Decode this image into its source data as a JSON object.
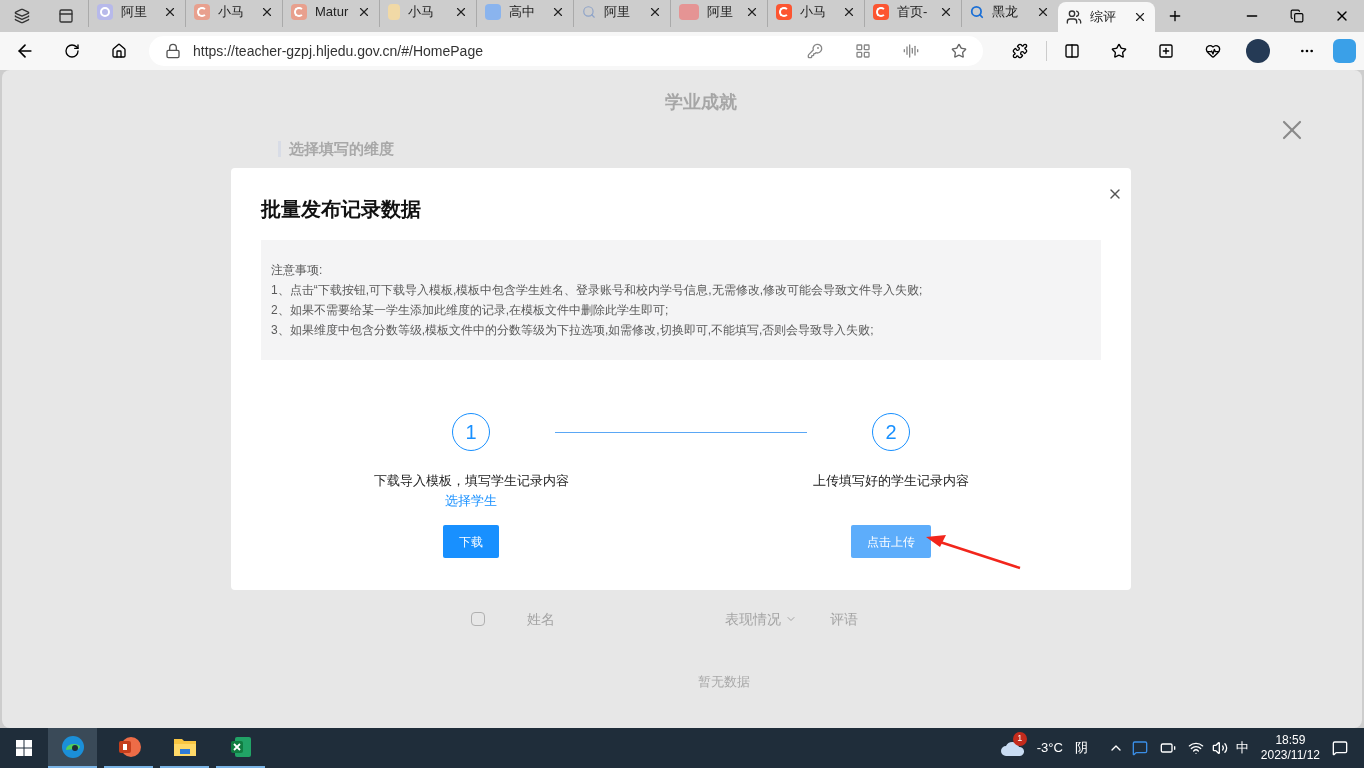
{
  "browser": {
    "tabs": [
      {
        "kind": "ring",
        "title": "阿里",
        "selected": false
      },
      {
        "kind": "c-logo",
        "title": "小马",
        "selected": false
      },
      {
        "kind": "c-logo",
        "title": "Matur",
        "selected": false
      },
      {
        "kind": "bookmark",
        "title": "小马",
        "selected": false
      },
      {
        "kind": "zhi",
        "title": "高中",
        "selected": false
      },
      {
        "kind": "search",
        "title": "阿里",
        "selected": false
      },
      {
        "kind": "it",
        "title": "阿里",
        "selected": false
      },
      {
        "kind": "c-bright",
        "title": "小马",
        "selected": false
      },
      {
        "kind": "c-bright",
        "title": "首页-",
        "selected": false
      },
      {
        "kind": "search-blue",
        "title": "黑龙",
        "selected": false
      },
      {
        "kind": "people",
        "title": "综评",
        "selected": true
      }
    ],
    "url": "https://teacher-gzpj.hljedu.gov.cn/#/HomePage"
  },
  "page": {
    "title": "学业成就",
    "section": "选择填写的维度",
    "columns": [
      "姓名",
      "表现情况",
      "评语"
    ],
    "select_all_checked": false,
    "empty_text": "暂无数据"
  },
  "dialog": {
    "title": "批量发布记录数据",
    "notice": [
      "注意事项:",
      "1、点击“下载按钮,可下载导入模板,模板中包含学生姓名、登录账号和校内学号信息,无需修改,修改可能会导致文件导入失败;",
      "2、如果不需要给某一学生添加此维度的记录,在模板文件中删除此学生即可;",
      "3、如果维度中包含分数等级,模板文件中的分数等级为下拉选项,如需修改,切换即可,不能填写,否则会导致导入失败;"
    ],
    "steps": [
      {
        "number": "1",
        "description": "下载导入模板，填写学生记录内容",
        "link": "选择学生",
        "button": "下载",
        "disabled": false
      },
      {
        "number": "2",
        "description": "上传填写好的学生记录内容",
        "button": "点击上传",
        "disabled": true
      }
    ]
  },
  "taskbar": {
    "apps": [
      {
        "kind": "edge",
        "selected": true
      },
      {
        "kind": "powerpoint",
        "selected": false
      },
      {
        "kind": "explorer",
        "selected": false
      },
      {
        "kind": "excel",
        "selected": false
      }
    ],
    "weather": {
      "badge": "1",
      "temperature": "-3°C",
      "condition": "阴"
    },
    "ime": "中",
    "time": "18:59",
    "date": "2023/11/12"
  }
}
